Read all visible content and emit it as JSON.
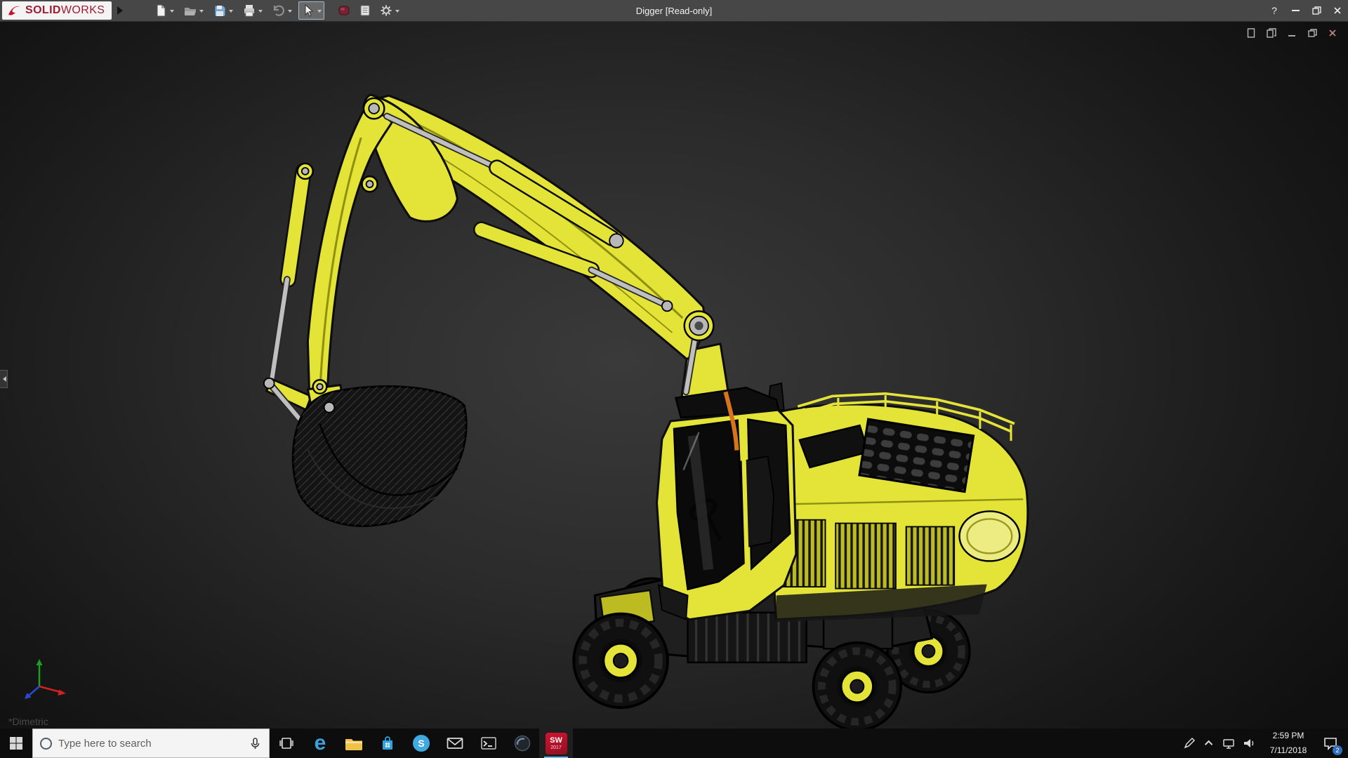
{
  "window": {
    "brand": {
      "name_bold": "SOLID",
      "name_light": "WORKS"
    },
    "title": "Digger [Read-only]",
    "help_glyph": "?",
    "toolbar_icon_names": [
      "new-document",
      "open",
      "save",
      "print",
      "undo",
      "select-cursor",
      "appearance",
      "document-properties",
      "options-gear"
    ],
    "window_control_names": [
      "help",
      "minimize",
      "restore",
      "close"
    ]
  },
  "viewport": {
    "view_orientation_label": "*Dimetric",
    "doc_window_control_names": [
      "new-window",
      "cascade-window",
      "minimize-doc",
      "restore-doc",
      "close-doc"
    ],
    "triad_axis_names": [
      "x-axis",
      "y-axis",
      "z-axis"
    ],
    "model_part_names": [
      "boom",
      "dipper-arm",
      "bucket",
      "hydraulic-cylinders",
      "cab",
      "engine-hood",
      "undercarriage",
      "wheels"
    ]
  },
  "taskbar": {
    "search_placeholder": "Type here to search",
    "app_icon_names": [
      "start",
      "cortana",
      "microphone",
      "task-view",
      "edge",
      "file-explorer",
      "store",
      "skype",
      "mail",
      "console",
      "app-circle",
      "solidworks-2017"
    ],
    "edge_letter": "e",
    "skype_letter": "S",
    "solidworks_icon": {
      "label": "SW",
      "year": "2017"
    },
    "tray": {
      "icon_names": [
        "pen",
        "chevron-up",
        "network",
        "volume",
        "action-center"
      ],
      "time": "2:59 PM",
      "date": "7/11/2018",
      "notification_count": "2"
    }
  },
  "colors": {
    "titlebar_bg": "#474747",
    "taskbar_bg": "#0d0d0d",
    "brand_red": "#9e1b32",
    "accent_yellow": "#e4e438",
    "yellow_dark": "#bcbc22",
    "yellow_deep": "#8f8f12",
    "outline": "#0d0d0d",
    "orange_accent": "#d8741e",
    "edge_blue": "#38a3dc",
    "folder_yellow": "#f0c14b",
    "badge_blue": "#2f6fba",
    "axis_x_red": "#d42020",
    "axis_y_green": "#1ca01c",
    "axis_z_blue": "#2a48d8"
  }
}
